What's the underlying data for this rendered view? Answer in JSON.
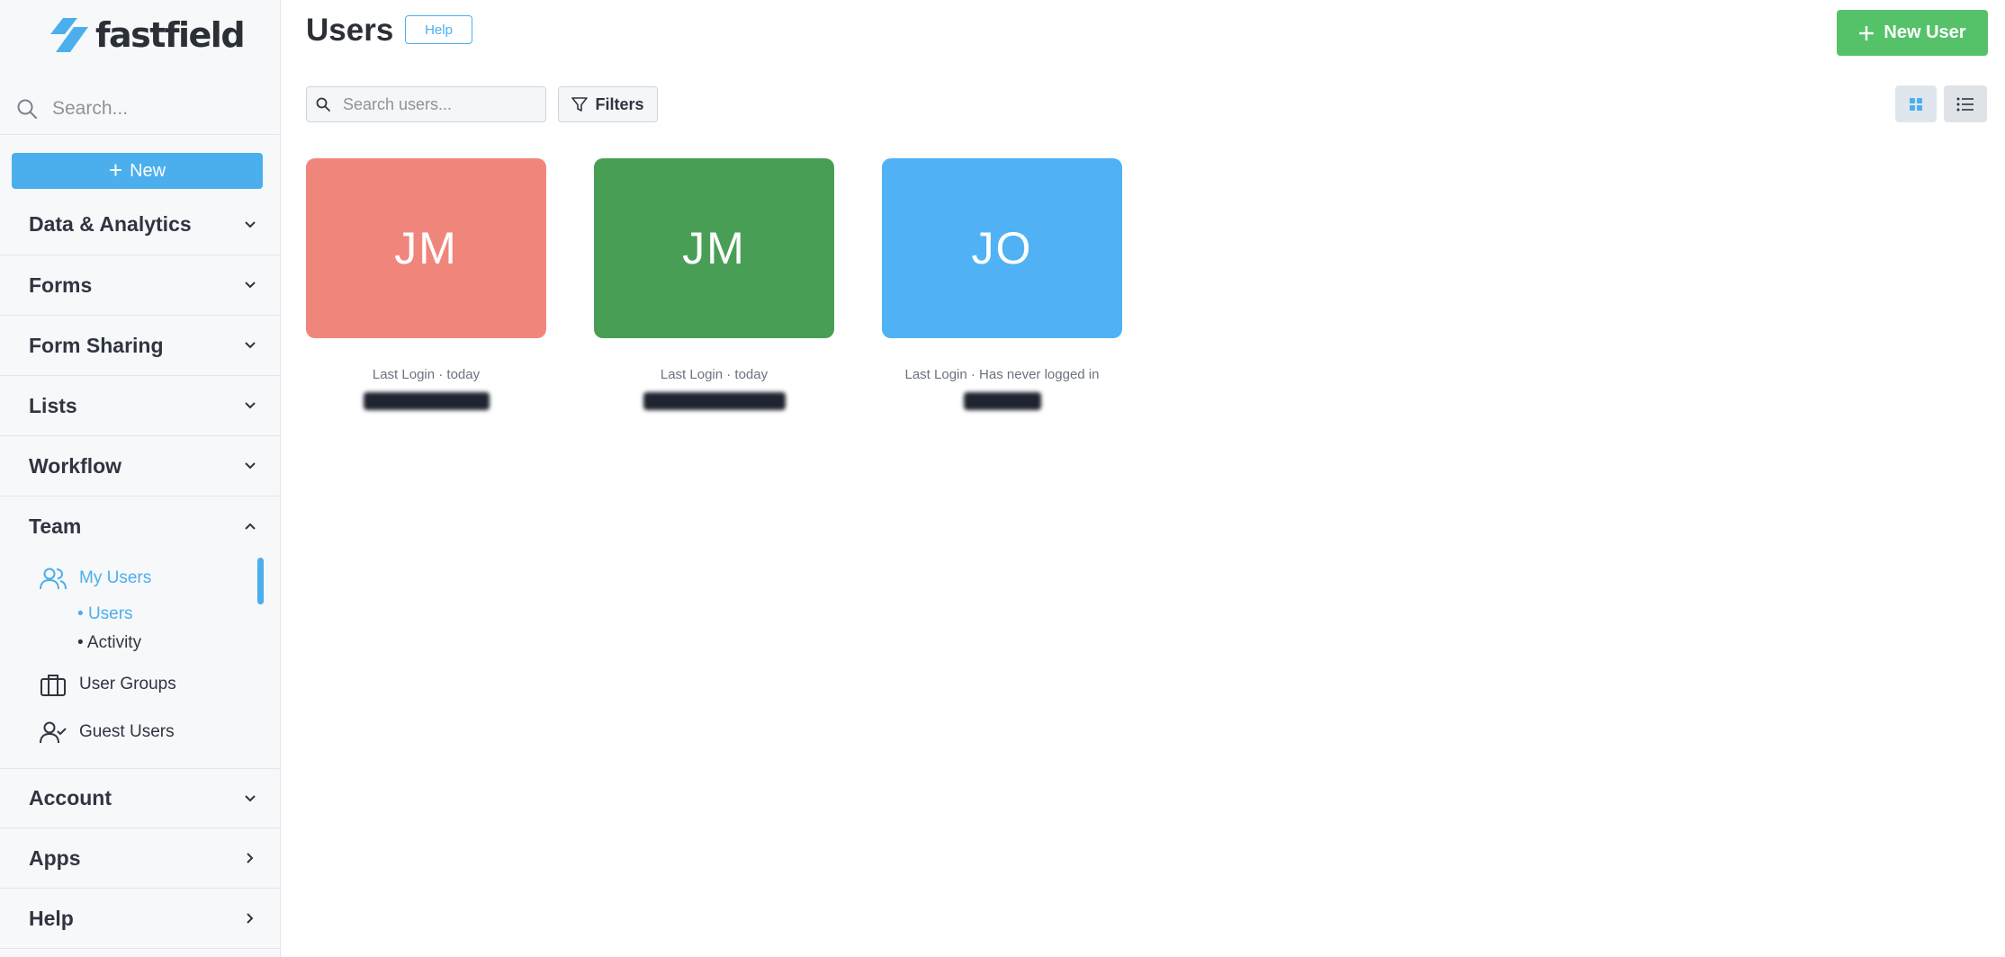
{
  "brand": {
    "name": "fastfield"
  },
  "sidebar": {
    "search_placeholder": "Search...",
    "new_button": "New",
    "sections": [
      {
        "label": "Data & Analytics",
        "chevron": "chevron-down-icon"
      },
      {
        "label": "Forms",
        "chevron": "chevron-down-icon"
      },
      {
        "label": "Form Sharing",
        "chevron": "chevron-down-icon"
      },
      {
        "label": "Lists",
        "chevron": "chevron-down-icon"
      },
      {
        "label": "Workflow",
        "chevron": "chevron-down-icon"
      },
      {
        "label": "Team",
        "chevron": "chevron-up-icon"
      },
      {
        "label": "Account",
        "chevron": "chevron-down-icon"
      },
      {
        "label": "Apps",
        "chevron": "chevron-right-icon"
      },
      {
        "label": "Help",
        "chevron": "chevron-right-icon"
      }
    ],
    "team": {
      "my_users": "My Users",
      "sub_users": "Users",
      "sub_activity": "Activity",
      "user_groups": "User Groups",
      "guest_users": "Guest Users"
    }
  },
  "header": {
    "title": "Users",
    "help_button": "Help",
    "new_user_button": "New User"
  },
  "toolbar": {
    "search_placeholder": "Search users...",
    "filters_button": "Filters"
  },
  "users": [
    {
      "initials": "JM",
      "color": "#f0867b",
      "last_login": "Last Login · today"
    },
    {
      "initials": "JM",
      "color": "#499e56",
      "last_login": "Last Login · today"
    },
    {
      "initials": "JO",
      "color": "#50b2f5",
      "last_login": "Last Login · Has never logged in"
    }
  ],
  "colors": {
    "accent": "#4bafed",
    "success": "#55c26a"
  }
}
